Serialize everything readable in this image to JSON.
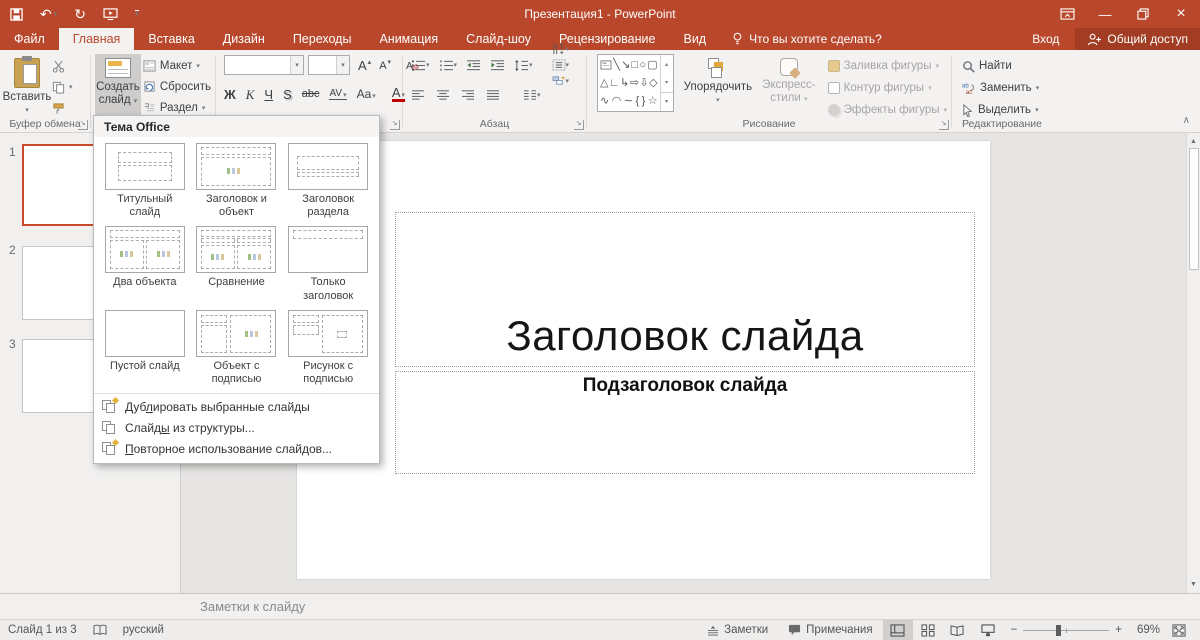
{
  "colors": {
    "accent": "#B9472B",
    "share_bg": "#A23D23",
    "selected_slide_border": "#C8492C",
    "new_slide_accent": "#E8B64C"
  },
  "window": {
    "title": "Презентация1 - PowerPoint",
    "signin": "Вход",
    "share": "Общий доступ"
  },
  "tabs": [
    "Файл",
    "Главная",
    "Вставка",
    "Дизайн",
    "Переходы",
    "Анимация",
    "Слайд-шоу",
    "Рецензирование",
    "Вид"
  ],
  "tellme": "Что вы хотите сделать?",
  "ribbon": {
    "paste": "Вставить",
    "clipboard_group": "Буфер обмена",
    "new_slide_line1": "Создать",
    "new_slide_line2": "слайд",
    "layout": "Макет",
    "reset": "Сбросить",
    "section": "Раздел",
    "bold": "Ж",
    "italic": "К",
    "underline": "Ч",
    "shadow": "S",
    "strike": "abc",
    "spacing": "AV",
    "case": "Aa",
    "font_color": "A",
    "grow_font": "A",
    "shrink_font": "A",
    "paragraph_group": "Абзац",
    "arrange": "Упорядочить",
    "styles_line1": "Экспресс-",
    "styles_line2": "стили",
    "fill": "Заливка фигуры",
    "outline": "Контур фигуры",
    "effects": "Эффекты фигуры",
    "drawing_group": "Рисование",
    "find": "Найти",
    "replace": "Заменить",
    "select": "Выделить",
    "editing_group": "Редактирование"
  },
  "shapes": {
    "r1": [
      "╲",
      "↘",
      "□",
      "○",
      "▢"
    ],
    "r2": [
      "△",
      "∟",
      "↳",
      "⇨",
      "⇩",
      "◇"
    ],
    "r3": [
      "∿",
      "◠",
      "∼",
      "{",
      "}",
      "☆"
    ]
  },
  "dropdown": {
    "header": "Тема Office",
    "layouts": [
      {
        "label": "Титульный слайд"
      },
      {
        "label": "Заголовок и объект"
      },
      {
        "label": "Заголовок раздела"
      },
      {
        "label": "Два объекта"
      },
      {
        "label": "Сравнение"
      },
      {
        "label": "Только заголовок"
      },
      {
        "label": "Пустой слайд"
      },
      {
        "label": "Объект с подписью"
      },
      {
        "label": "Рисунок с подписью"
      }
    ],
    "items": [
      {
        "pre": "Дуб",
        "accel": "л",
        "post": "ировать выбранные слайды"
      },
      {
        "pre": "Слайд",
        "accel": "ы",
        "post": " из структуры..."
      },
      {
        "pre": "",
        "accel": "П",
        "post": "овторное использование слайдов..."
      }
    ]
  },
  "panel": {
    "numbers": [
      "1",
      "2",
      "3"
    ]
  },
  "slide": {
    "title": "Заголовок слайда",
    "subtitle": "Подзаголовок слайда"
  },
  "notes": {
    "label": "Заметки к слайду"
  },
  "statusbar": {
    "slide_info": "Слайд 1 из 3",
    "language": "русский",
    "notes": "Заметки",
    "comments": "Примечания",
    "zoom": "69%"
  },
  "icons": {
    "undo": "↶",
    "redo": "↻",
    "caret": "▾",
    "caret_up": "▴",
    "minimize": "—",
    "close": "×",
    "collapse": "∧",
    "scroll_up": "▲",
    "scroll_down": "▼",
    "zoom_out": "−",
    "zoom_in": "+",
    "launcher": "↘"
  }
}
